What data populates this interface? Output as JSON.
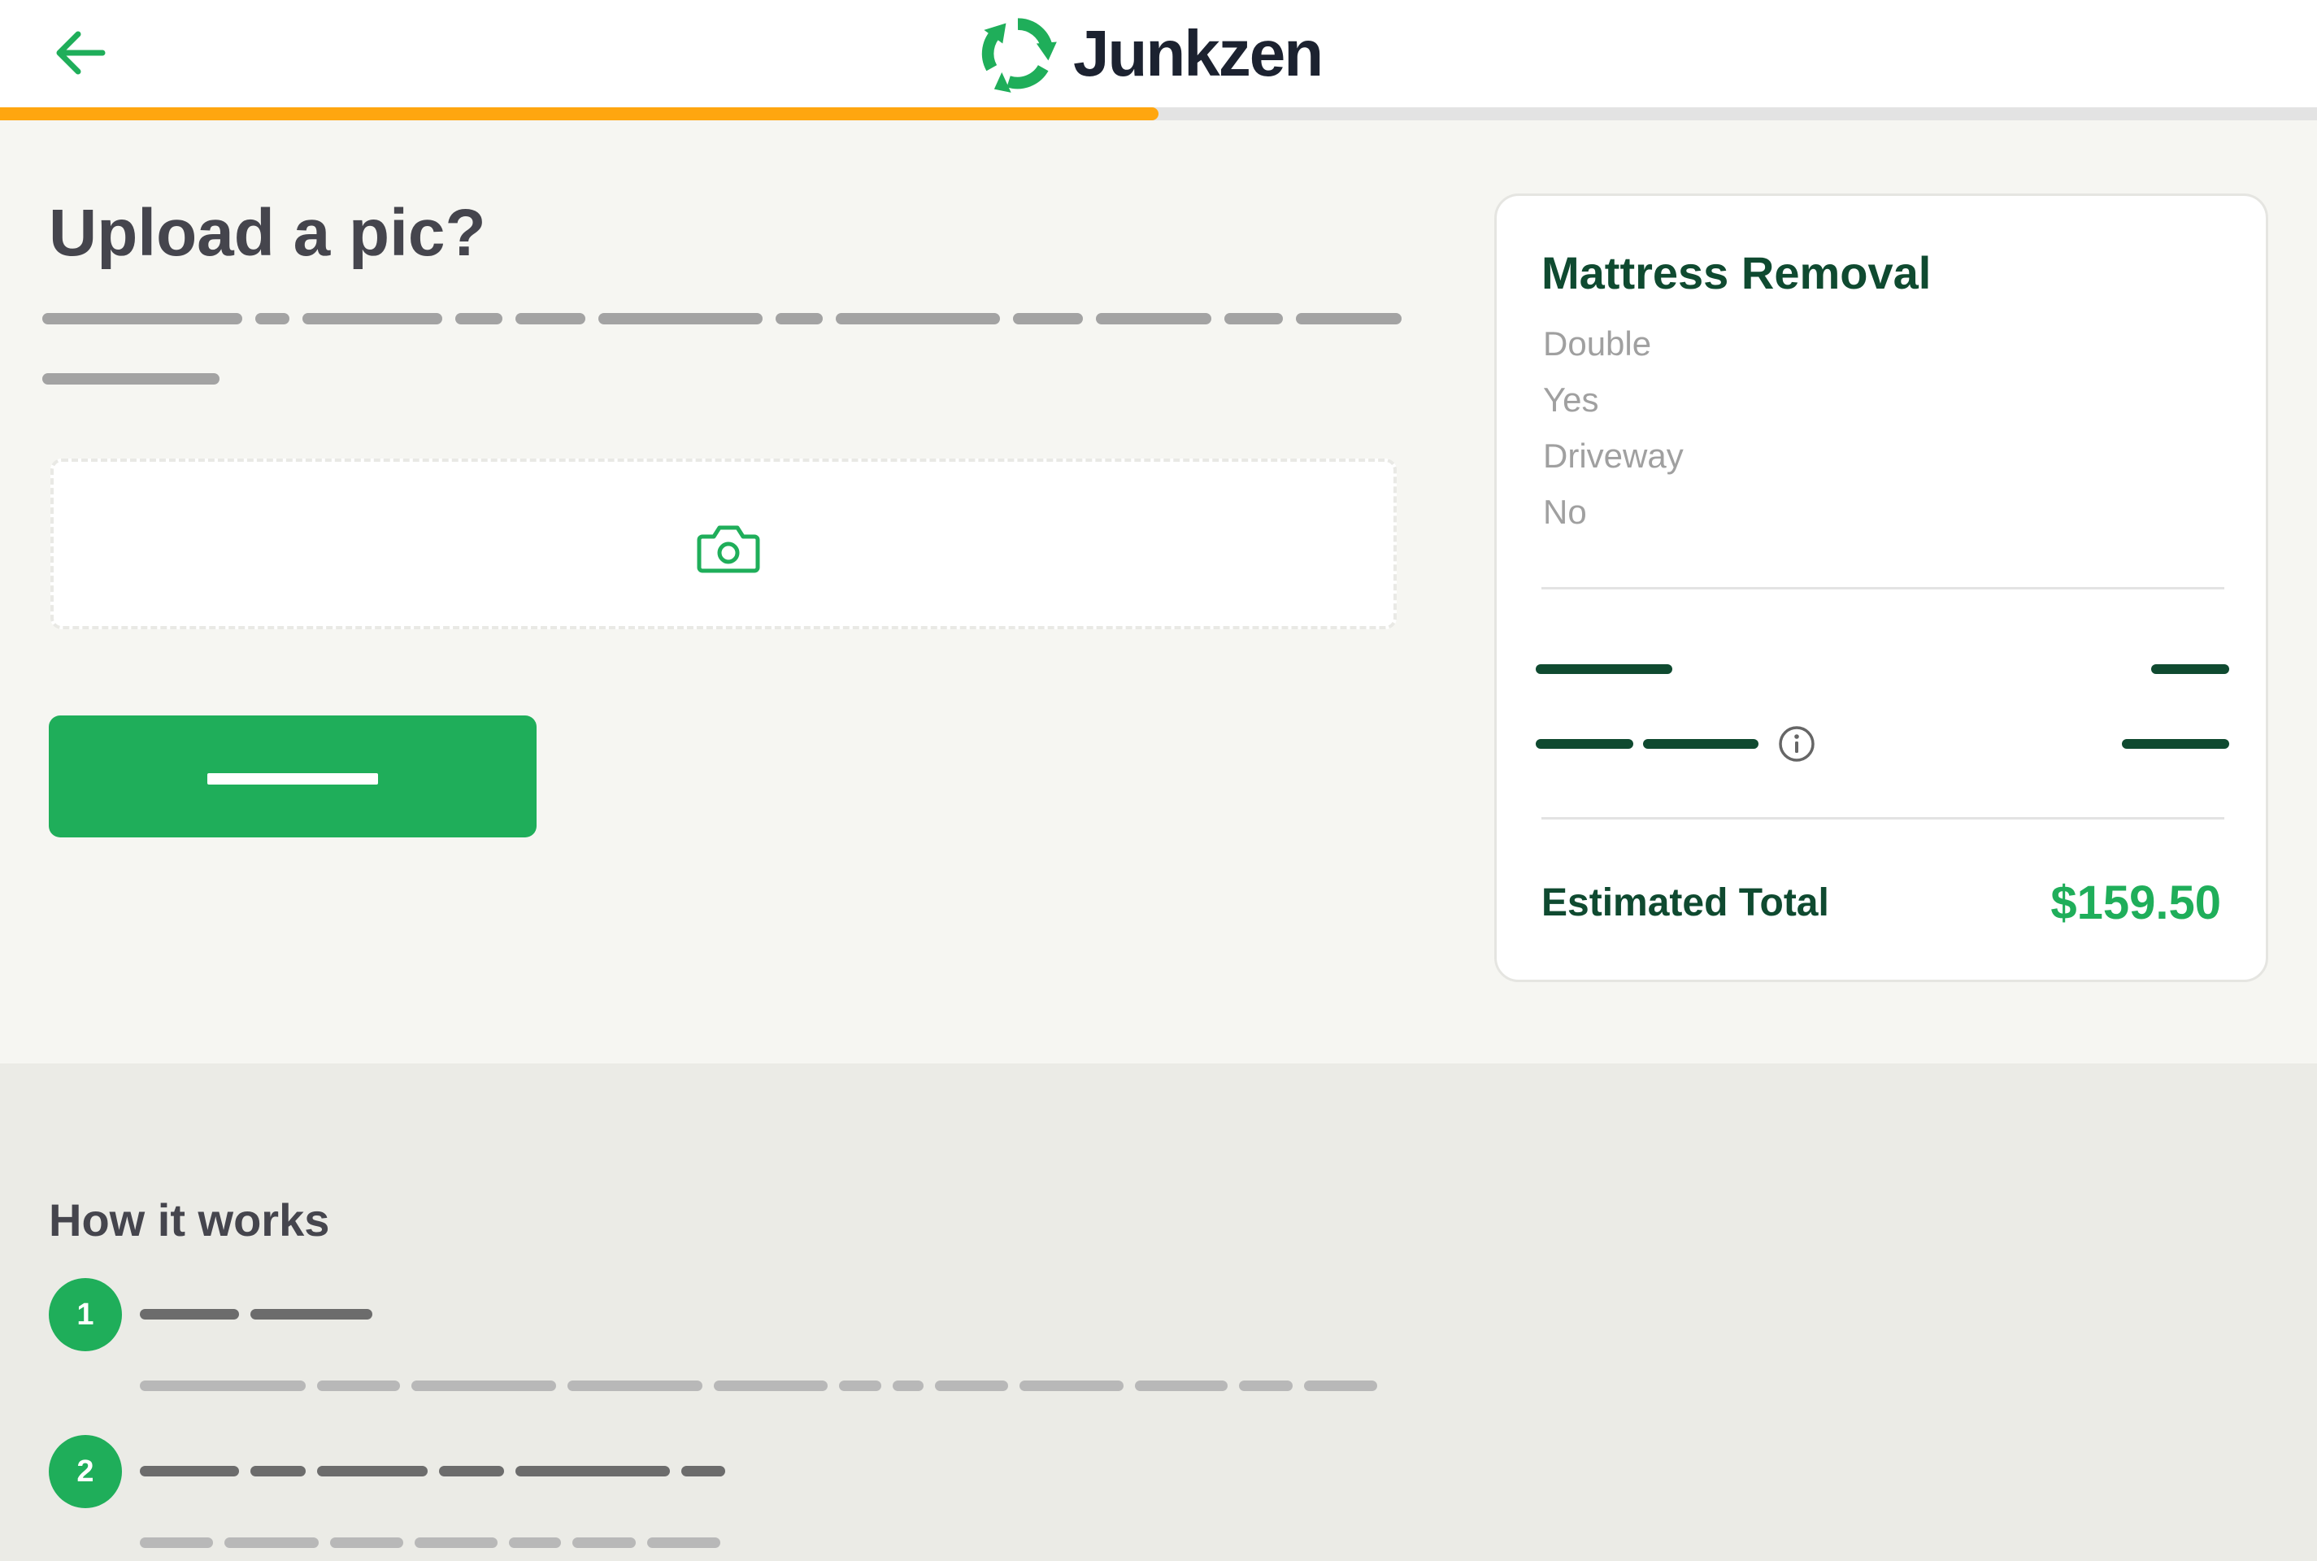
{
  "header": {
    "back_icon": "arrow-left-icon",
    "logo_icon": "recycle-arrows-icon",
    "logo_text": "Junkzen",
    "progress_fraction": 0.5,
    "colors": {
      "accent_green": "#1fae5a",
      "progress_orange": "#ffa60f",
      "dark_green": "#0f4a30"
    }
  },
  "main": {
    "title": "Upload a pic?",
    "upload": {
      "icon": "camera-icon"
    }
  },
  "summary": {
    "title": "Mattress Removal",
    "details": [
      "Double",
      "Yes",
      "Driveway",
      "No"
    ],
    "info_icon": "info-icon",
    "total_label": "Estimated Total",
    "total_value": "$159.50"
  },
  "how_it_works": {
    "title": "How it works",
    "steps": [
      {
        "number": "1"
      },
      {
        "number": "2"
      }
    ]
  }
}
